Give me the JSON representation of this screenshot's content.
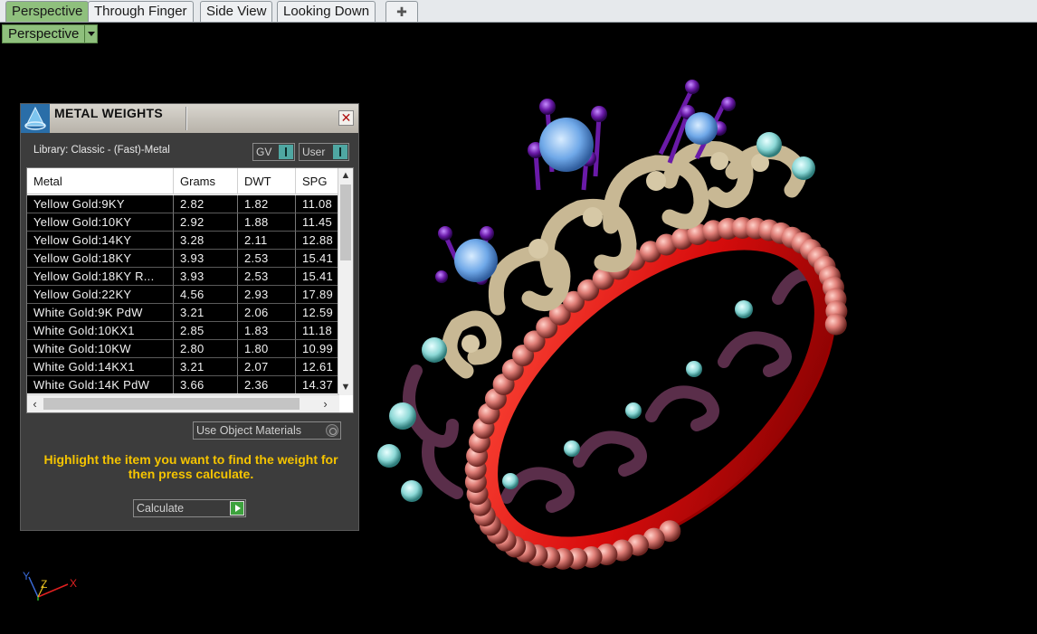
{
  "tabs": [
    {
      "label": "Perspective",
      "active": true
    },
    {
      "label": "Through Finger",
      "active": false
    },
    {
      "label": "Side View",
      "active": false
    },
    {
      "label": "Looking Down",
      "active": false
    }
  ],
  "add_tab_icon": "plus-icon",
  "viewport": {
    "label": "Perspective",
    "dropdown_icon": "chevron-down-icon"
  },
  "panel": {
    "title": "METAL WEIGHTS",
    "library_label": "Library: Classic - (Fast)-Metal",
    "toggle_gv": "GV",
    "toggle_user": "User",
    "columns": [
      "Metal",
      "Grams",
      "DWT",
      "SPG"
    ],
    "rows": [
      [
        "Yellow Gold:9KY",
        "2.82",
        "1.82",
        "11.08"
      ],
      [
        "Yellow Gold:10KY",
        "2.92",
        "1.88",
        "11.45"
      ],
      [
        "Yellow Gold:14KY",
        "3.28",
        "2.11",
        "12.88"
      ],
      [
        "Yellow Gold:18KY",
        "3.93",
        "2.53",
        "15.41"
      ],
      [
        "Yellow Gold:18KY R...",
        "3.93",
        "2.53",
        "15.41"
      ],
      [
        "Yellow Gold:22KY",
        "4.56",
        "2.93",
        "17.89"
      ],
      [
        "White Gold:9K PdW",
        "3.21",
        "2.06",
        "12.59"
      ],
      [
        "White Gold:10KX1",
        "2.85",
        "1.83",
        "11.18"
      ],
      [
        "White Gold:10KW",
        "2.80",
        "1.80",
        "10.99"
      ],
      [
        "White Gold:14KX1",
        "3.21",
        "2.07",
        "12.61"
      ],
      [
        "White Gold:14K PdW",
        "3.66",
        "2.36",
        "14.37"
      ]
    ],
    "use_object_materials": "Use Object Materials",
    "hint": "Highlight the item you want to find the weight for then press calculate.",
    "calculate": "Calculate"
  },
  "axes": {
    "x": "X",
    "y": "Y",
    "z": "Z"
  },
  "colors": {
    "active_tab": "#8fc07d",
    "hint_text": "#f5c400",
    "gem_blue": "#6fa8e8",
    "ring_red": "#e01818",
    "gold": "#c8b894",
    "purple_prong": "#6a1aa8",
    "plum": "#5a2e4a"
  }
}
